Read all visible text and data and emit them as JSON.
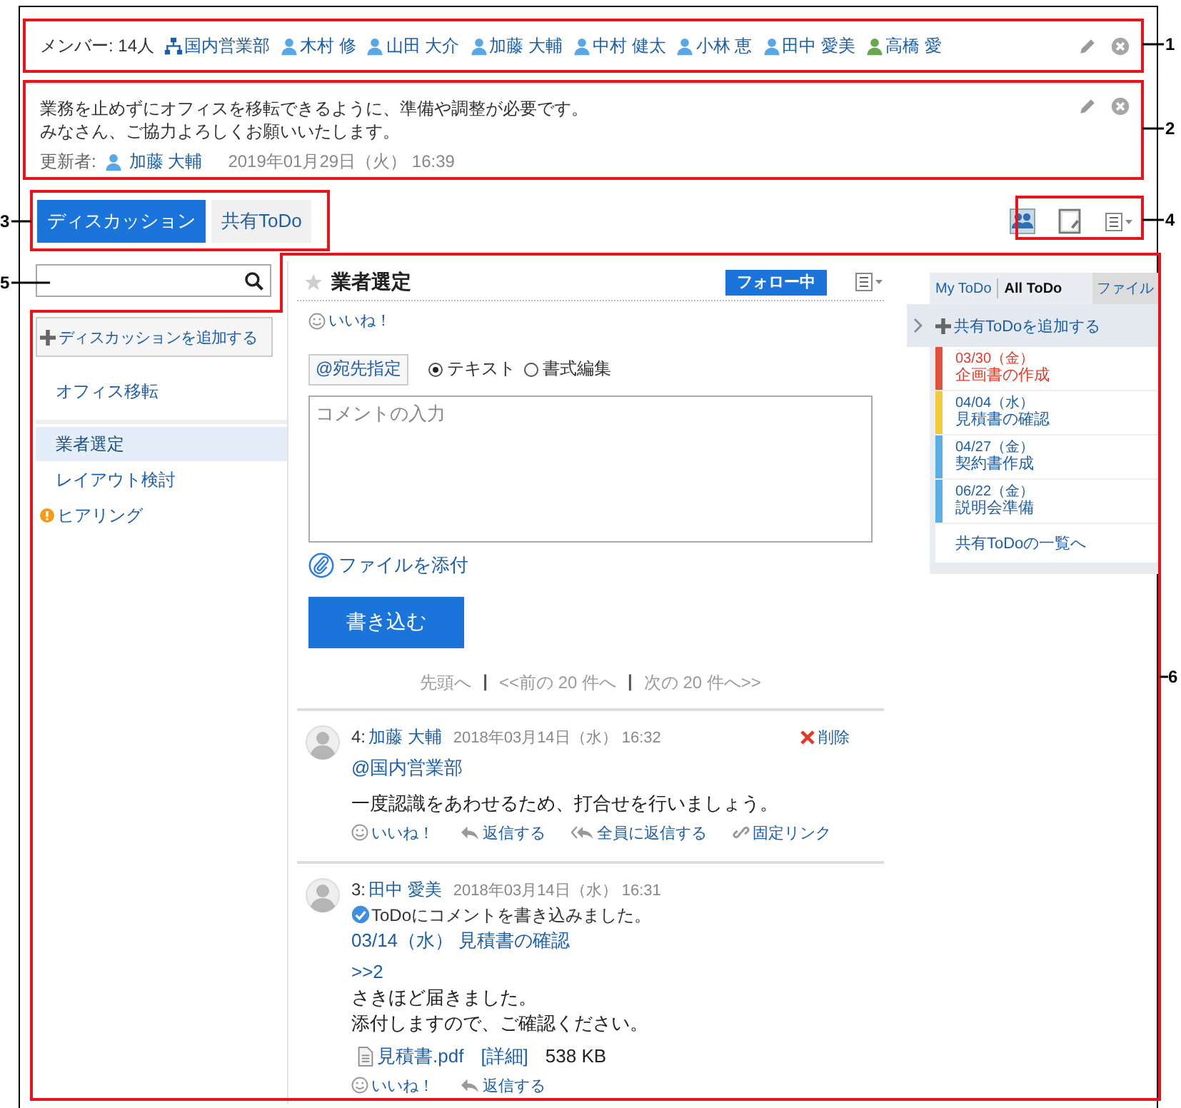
{
  "members": {
    "summary": "メンバー: 14人",
    "items": [
      {
        "kind": "group",
        "name": "国内営業部",
        "color": "#1d5fa6"
      },
      {
        "kind": "user",
        "name": "木村 修",
        "color": "#5aa7e6"
      },
      {
        "kind": "user",
        "name": "山田 大介",
        "color": "#5aa7e6"
      },
      {
        "kind": "user",
        "name": "加藤 大輔",
        "color": "#5aa7e6"
      },
      {
        "kind": "user",
        "name": "中村 健太",
        "color": "#5aa7e6"
      },
      {
        "kind": "user",
        "name": "小林 恵",
        "color": "#5aa7e6"
      },
      {
        "kind": "user",
        "name": "田中 愛美",
        "color": "#5aa7e6"
      },
      {
        "kind": "user",
        "name": "高橋 愛",
        "color": "#6aa84f"
      }
    ]
  },
  "description": {
    "lines": [
      "業務を止めずにオフィスを移転できるように、準備や調整が必要です。",
      "みなさん、ご協力よろしくお願いいたします。"
    ],
    "updated_label": "更新者:",
    "updated_by": "加藤 大輔",
    "updated_at": "2019年01月29日（火）  16:39"
  },
  "tabs": [
    {
      "label": "ディスカッション",
      "selected": true
    },
    {
      "label": "共有ToDo",
      "selected": false
    }
  ],
  "sidebar": {
    "add_button": "ディスカッションを追加する",
    "sections": [
      {
        "items": [
          {
            "label": "オフィス移転",
            "selected": false,
            "alert": false
          }
        ]
      },
      {
        "items": [
          {
            "label": "業者選定",
            "selected": true,
            "alert": false
          },
          {
            "label": "レイアウト検討",
            "selected": false,
            "alert": false
          },
          {
            "label": "ヒアリング",
            "selected": false,
            "alert": true
          }
        ]
      }
    ]
  },
  "thread": {
    "title": "業者選定",
    "starred": false,
    "follow_button": "フォロー中",
    "like": "いいね！",
    "composer": {
      "mention_button": "@宛先指定",
      "modes": [
        {
          "label": "テキスト",
          "selected": true
        },
        {
          "label": "書式編集",
          "selected": false
        }
      ],
      "placeholder": "コメントの入力",
      "attach": "ファイルを添付",
      "submit": "書き込む"
    },
    "pagination": {
      "separator": "|",
      "items": [
        "先頭へ",
        "<<前の 20 件へ",
        "次の 20 件へ>>"
      ]
    },
    "comments": [
      {
        "number": "4:",
        "author": "加藤 大輔",
        "date": "2018年03月14日（水） 16:32",
        "delete": "削除",
        "mention": "@国内営業部",
        "body": [
          "一度認識をあわせるため、打合せを行いましょう。"
        ],
        "actions": [
          {
            "kind": "like",
            "label": "いいね！"
          },
          {
            "kind": "reply",
            "label": "返信する"
          },
          {
            "kind": "reply-all",
            "label": "全員に返信する"
          },
          {
            "kind": "link",
            "label": "固定リンク"
          }
        ]
      },
      {
        "number": "3:",
        "author": "田中 愛美",
        "date": "2018年03月14日（水） 16:31",
        "notice": "ToDoにコメントを書き込みました。",
        "todo_link": "03/14（水）  見積書の確認",
        "quote": ">>2",
        "body": [
          "さきほど届きました。",
          "添付しますので、ご確認ください。"
        ],
        "attachment": {
          "name": "見積書.pdf",
          "details": "[詳細]",
          "size": "538 KB"
        },
        "actions": [
          {
            "kind": "like",
            "label": "いいね！"
          },
          {
            "kind": "reply",
            "label": "返信する"
          }
        ]
      }
    ]
  },
  "todo_panel": {
    "tabs": [
      {
        "kind": "filter",
        "label": "My ToDo",
        "selected": false
      },
      {
        "kind": "filter",
        "label": "All ToDo",
        "selected": true
      },
      {
        "kind": "tab",
        "label": "ファイル",
        "selected": false
      }
    ],
    "add": "共有ToDoを追加する",
    "items": [
      {
        "date": "03/30（金）",
        "title": "企画書の作成",
        "color": "#e0503a",
        "overdue": true
      },
      {
        "date": "04/04（水）",
        "title": "見積書の確認",
        "color": "#f5c93c",
        "overdue": false
      },
      {
        "date": "04/27（金）",
        "title": "契約書作成",
        "color": "#5aaee6",
        "overdue": false
      },
      {
        "date": "06/22（金）",
        "title": "説明会準備",
        "color": "#5aaee6",
        "overdue": false
      }
    ],
    "list_link": "共有ToDoの一覧へ"
  },
  "callouts": [
    "1",
    "2",
    "3",
    "4",
    "5",
    "6"
  ]
}
